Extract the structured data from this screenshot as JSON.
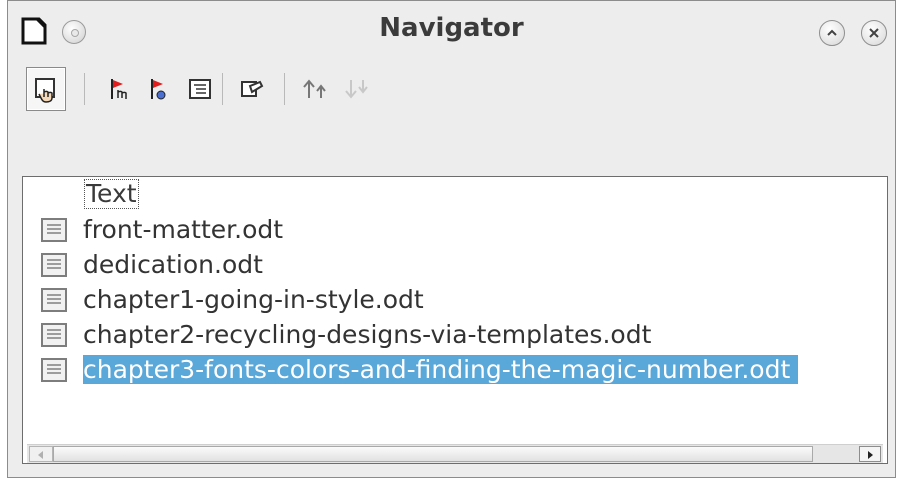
{
  "window": {
    "title": "Navigator"
  },
  "toolbar": {
    "buttons": [
      {
        "icon": "drag-mode-icon",
        "active": true
      },
      {
        "icon": "promote-chapter-icon"
      },
      {
        "icon": "demote-chapter-icon"
      },
      {
        "icon": "content-view-icon"
      },
      {
        "icon": "edit-icon"
      },
      {
        "icon": "move-up-icon"
      },
      {
        "icon": "move-down-icon"
      }
    ]
  },
  "tree": {
    "root_label": "Text",
    "items": [
      {
        "label": "front-matter.odt"
      },
      {
        "label": "dedication.odt"
      },
      {
        "label": "chapter1-going-in-style.odt"
      },
      {
        "label": "chapter2-recycling-designs-via-templates.odt"
      },
      {
        "label": "chapter3-fonts-colors-and-finding-the-magic-number.odt",
        "selected": true
      }
    ]
  },
  "colors": {
    "selection": "#5aa7d9",
    "window_bg": "#ededed",
    "title_text": "#3b3b3b"
  }
}
